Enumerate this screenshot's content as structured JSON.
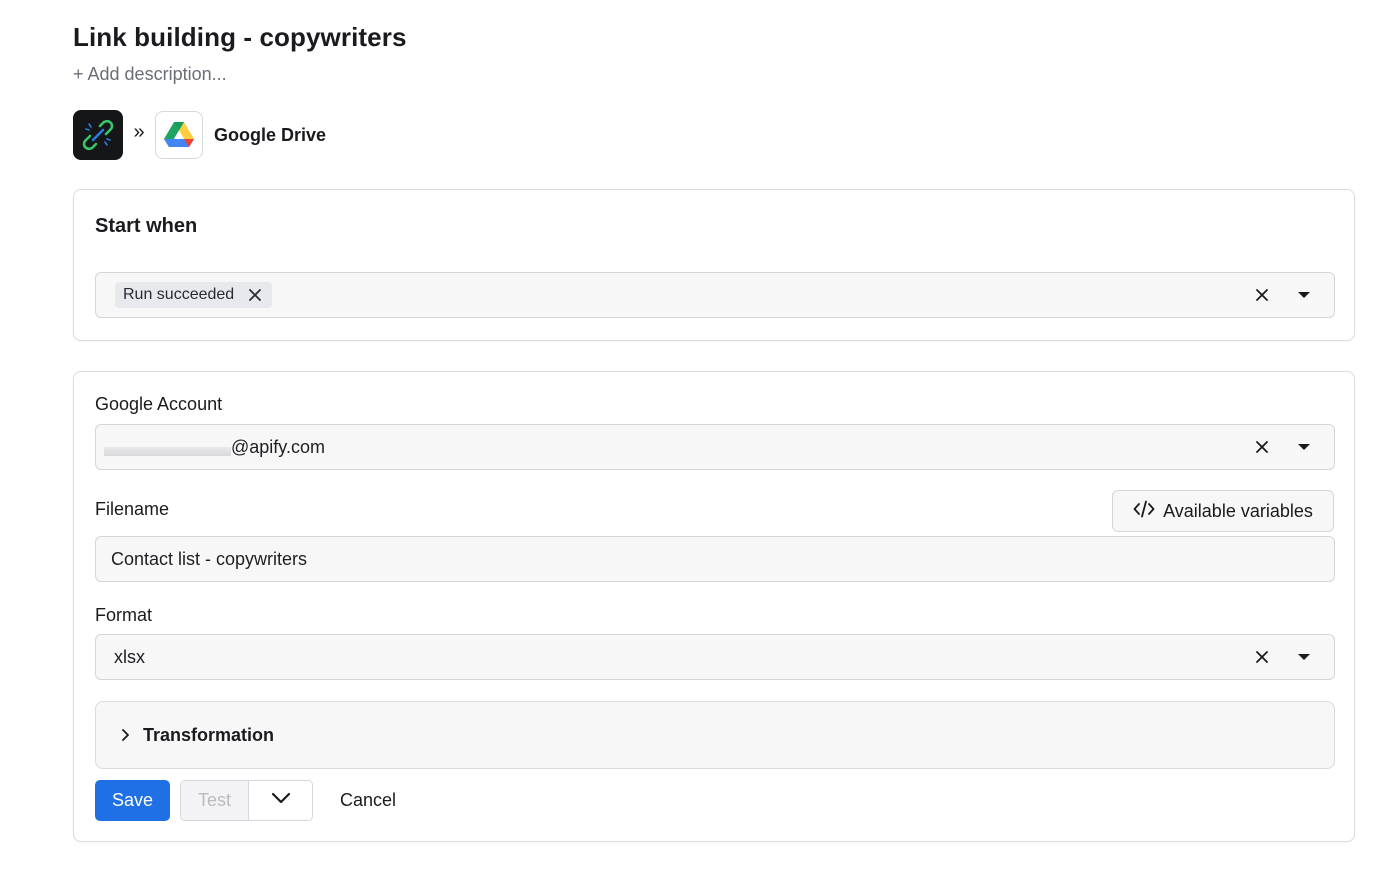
{
  "header": {
    "title": "Link building - copywriters",
    "add_description": "+ Add description..."
  },
  "integration": {
    "source_icon": "link-chain-icon",
    "separator_icon": "double-chevron-right-icon",
    "target_icon": "google-drive-icon",
    "target_name": "Google Drive"
  },
  "start_when": {
    "heading": "Start when",
    "selected_tags": [
      "Run succeeded"
    ]
  },
  "google_account": {
    "label": "Google Account",
    "value_suffix": "@apify.com"
  },
  "filename": {
    "label": "Filename",
    "value": "Contact list - copywriters",
    "variables_button": "Available variables"
  },
  "format": {
    "label": "Format",
    "value": "xlsx"
  },
  "transformation": {
    "label": "Transformation"
  },
  "actions": {
    "save": "Save",
    "test": "Test",
    "cancel": "Cancel"
  },
  "colors": {
    "primary": "#1f6fe5",
    "app_icon_bg": "#141618",
    "field_bg": "#f7f7f8"
  }
}
